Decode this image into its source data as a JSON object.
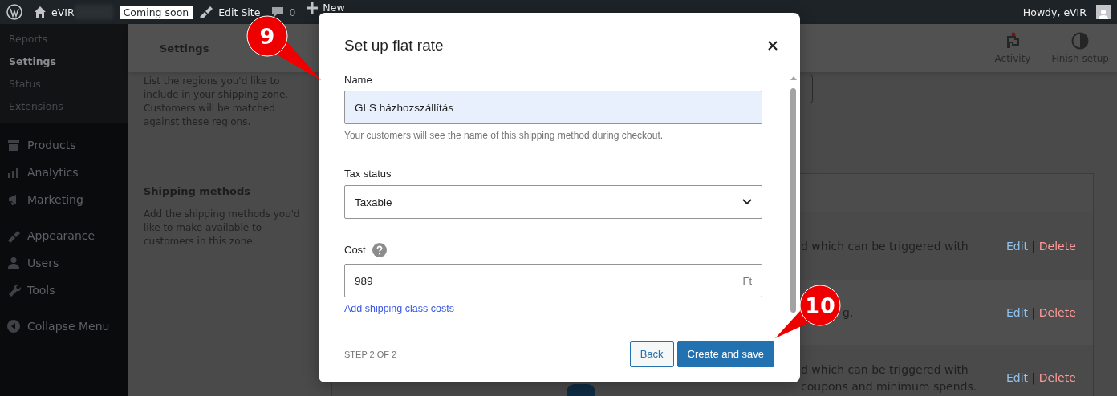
{
  "admin_bar": {
    "site_name": "eVIR",
    "badge": "Coming soon",
    "edit_site": "Edit Site",
    "comments": "0",
    "new": "New",
    "greeting": "Howdy, eVIR"
  },
  "sidebar": {
    "submenu": [
      {
        "label": "Reports",
        "selected": false
      },
      {
        "label": "Settings",
        "selected": true
      },
      {
        "label": "Status",
        "selected": false
      },
      {
        "label": "Extensions",
        "selected": false
      }
    ],
    "items": [
      {
        "label": "Products"
      },
      {
        "label": "Analytics"
      },
      {
        "label": "Marketing"
      },
      {
        "label": "Appearance"
      },
      {
        "label": "Users"
      },
      {
        "label": "Tools"
      },
      {
        "label": "Collapse Menu"
      }
    ]
  },
  "header": {
    "title": "Settings",
    "actions": [
      {
        "label": "Activity"
      },
      {
        "label": "Finish setup"
      }
    ]
  },
  "sections": [
    {
      "description": "List the regions you'd like to include in your shipping zone. Customers will be matched against these regions."
    },
    {
      "title": "Shipping methods",
      "description": "Add the shipping methods you'd like to make available to customers in this zone."
    }
  ],
  "methods_table": {
    "rows": [
      {
        "description": [
          "d which can be triggered with"
        ],
        "edit": "Edit",
        "separator": "|",
        "delete": "Delete"
      },
      {
        "description": [
          "g."
        ],
        "edit": "Edit",
        "separator": "|",
        "delete": "Delete"
      },
      {
        "description": [
          "d which can be triggered with",
          "coupons and minimum spends."
        ],
        "edit": "Edit",
        "separator": "|",
        "delete": "Delete",
        "enabled": true
      }
    ]
  },
  "modal": {
    "title": "Set up flat rate",
    "name": {
      "label": "Name",
      "value": "GLS házhozszállítás",
      "help": "Your customers will see the name of this shipping method during checkout."
    },
    "tax_status": {
      "label": "Tax status",
      "value": "Taxable"
    },
    "cost": {
      "label": "Cost",
      "value": "989",
      "suffix": "Ft"
    },
    "link": "Add shipping class costs",
    "step": "STEP 2 OF 2",
    "buttons": [
      {
        "label": "Back",
        "kind": "secondary"
      },
      {
        "label": "Create and save",
        "kind": "primary"
      }
    ]
  },
  "callouts": [
    {
      "number": "9"
    },
    {
      "number": "10"
    }
  ]
}
